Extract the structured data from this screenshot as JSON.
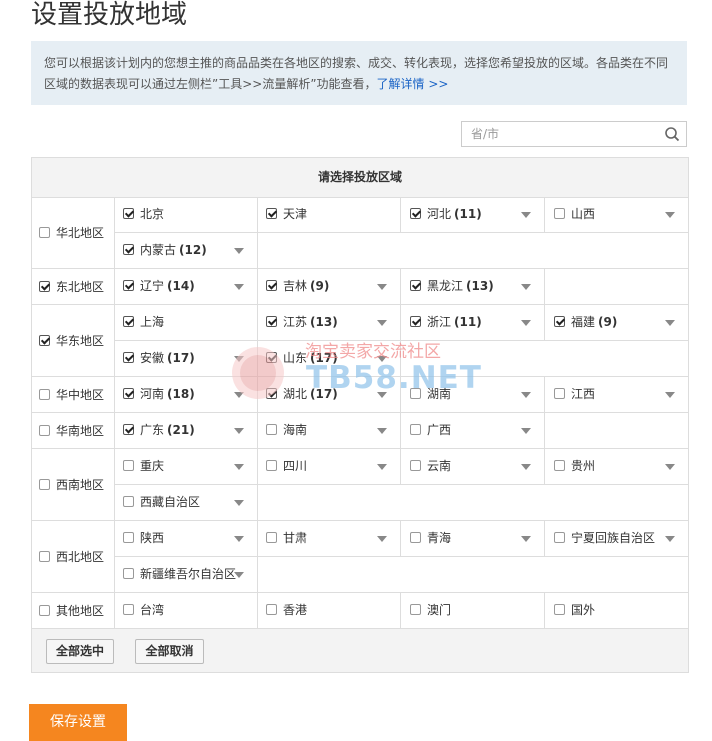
{
  "page_title": "设置投放地域",
  "notice": {
    "text": "您可以根据该计划内的您想主推的商品品类在各地区的搜索、成交、转化表现，选择您希望投放的区域。各品类在不同区域的数据表现可以通过左侧栏”工具>>流量解析”功能查看，",
    "link": "了解详情 >>"
  },
  "search": {
    "placeholder": "省/市"
  },
  "panel_header": "请选择投放区域",
  "regions": [
    {
      "name": "华北地区",
      "checked": false,
      "provinces": [
        {
          "name": "北京",
          "count": "",
          "checked": true,
          "dropdown": false
        },
        {
          "name": "天津",
          "count": "",
          "checked": true,
          "dropdown": false
        },
        {
          "name": "河北",
          "count": "(11)",
          "checked": true,
          "dropdown": true
        },
        {
          "name": "山西",
          "count": "",
          "checked": false,
          "dropdown": true
        },
        {
          "name": "内蒙古",
          "count": "(12)",
          "checked": true,
          "dropdown": true
        }
      ]
    },
    {
      "name": "东北地区",
      "checked": true,
      "provinces": [
        {
          "name": "辽宁",
          "count": "(14)",
          "checked": true,
          "dropdown": true
        },
        {
          "name": "吉林",
          "count": "(9)",
          "checked": true,
          "dropdown": true
        },
        {
          "name": "黑龙江",
          "count": "(13)",
          "checked": true,
          "dropdown": true
        }
      ]
    },
    {
      "name": "华东地区",
      "checked": true,
      "provinces": [
        {
          "name": "上海",
          "count": "",
          "checked": true,
          "dropdown": false
        },
        {
          "name": "江苏",
          "count": "(13)",
          "checked": true,
          "dropdown": true
        },
        {
          "name": "浙江",
          "count": "(11)",
          "checked": true,
          "dropdown": true
        },
        {
          "name": "福建",
          "count": "(9)",
          "checked": true,
          "dropdown": true
        },
        {
          "name": "安徽",
          "count": "(17)",
          "checked": true,
          "dropdown": true
        },
        {
          "name": "山东",
          "count": "(17)",
          "checked": true,
          "dropdown": true
        }
      ]
    },
    {
      "name": "华中地区",
      "checked": false,
      "provinces": [
        {
          "name": "河南",
          "count": "(18)",
          "checked": true,
          "dropdown": true
        },
        {
          "name": "湖北",
          "count": "(17)",
          "checked": true,
          "dropdown": true
        },
        {
          "name": "湖南",
          "count": "",
          "checked": false,
          "dropdown": true
        },
        {
          "name": "江西",
          "count": "",
          "checked": false,
          "dropdown": true
        }
      ]
    },
    {
      "name": "华南地区",
      "checked": false,
      "provinces": [
        {
          "name": "广东",
          "count": "(21)",
          "checked": true,
          "dropdown": true
        },
        {
          "name": "海南",
          "count": "",
          "checked": false,
          "dropdown": true
        },
        {
          "name": "广西",
          "count": "",
          "checked": false,
          "dropdown": true
        }
      ]
    },
    {
      "name": "西南地区",
      "checked": false,
      "provinces": [
        {
          "name": "重庆",
          "count": "",
          "checked": false,
          "dropdown": true
        },
        {
          "name": "四川",
          "count": "",
          "checked": false,
          "dropdown": true
        },
        {
          "name": "云南",
          "count": "",
          "checked": false,
          "dropdown": true
        },
        {
          "name": "贵州",
          "count": "",
          "checked": false,
          "dropdown": true
        },
        {
          "name": "西藏自治区",
          "count": "",
          "checked": false,
          "dropdown": true
        }
      ]
    },
    {
      "name": "西北地区",
      "checked": false,
      "provinces": [
        {
          "name": "陕西",
          "count": "",
          "checked": false,
          "dropdown": true
        },
        {
          "name": "甘肃",
          "count": "",
          "checked": false,
          "dropdown": true
        },
        {
          "name": "青海",
          "count": "",
          "checked": false,
          "dropdown": true
        },
        {
          "name": "宁夏回族自治区",
          "count": "",
          "checked": false,
          "dropdown": true
        },
        {
          "name": "新疆维吾尔自治区",
          "count": "",
          "checked": false,
          "dropdown": true
        }
      ]
    },
    {
      "name": "其他地区",
      "checked": false,
      "provinces": [
        {
          "name": "台湾",
          "count": "",
          "checked": false,
          "dropdown": false
        },
        {
          "name": "香港",
          "count": "",
          "checked": false,
          "dropdown": false
        },
        {
          "name": "澳门",
          "count": "",
          "checked": false,
          "dropdown": false
        },
        {
          "name": "国外",
          "count": "",
          "checked": false,
          "dropdown": false
        }
      ]
    }
  ],
  "buttons": {
    "select_all": "全部选中",
    "clear_all": "全部取消",
    "save": "保存设置"
  },
  "watermark": {
    "cn": "淘宝卖家交流社区",
    "en": "TB58.NET"
  },
  "colors": {
    "accent": "#f5861f",
    "link": "#1b64c6",
    "notice_bg": "#e6eef4"
  }
}
